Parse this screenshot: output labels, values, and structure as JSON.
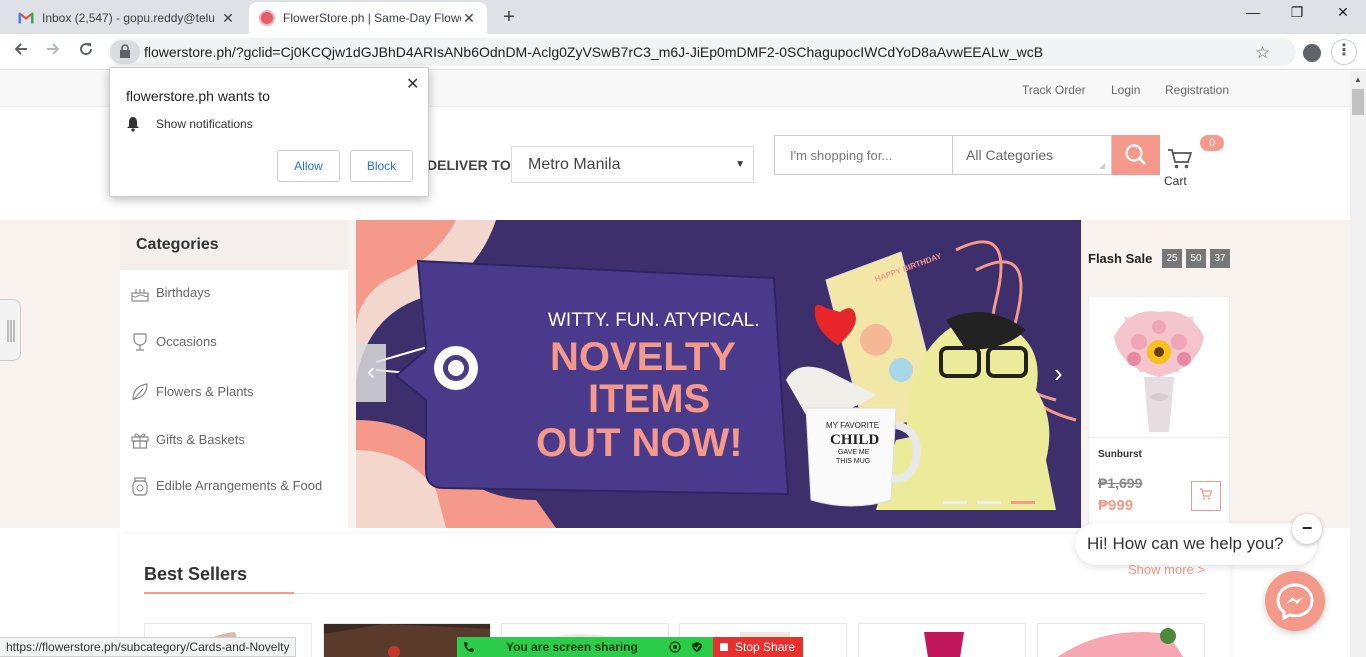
{
  "browser": {
    "tabs": [
      {
        "title": "Inbox (2,547) - gopu.reddy@telu",
        "close": "✕"
      },
      {
        "title": "FlowerStore.ph | Same-Day Flowe",
        "close": "✕"
      }
    ],
    "new_tab": "+",
    "url": "flowerstore.ph/?gclid=Cj0KCQjw1dGJBhD4ARIsANb6OdnDM-Aclg0ZyVSwB7rC3_m6J-JiEp0mDMF2-0SChagupocIWCdYoD8aAvwEEALw_wcB",
    "controls": {
      "minimize": "—",
      "restore": "❐",
      "close": "✕"
    }
  },
  "notification_popup": {
    "title": "flowerstore.ph wants to",
    "item": "Show notifications",
    "allow": "Allow",
    "block": "Block",
    "close": "✕"
  },
  "topbar": {
    "track_order": "Track Order",
    "login": "Login",
    "registration": "Registration"
  },
  "header": {
    "deliver_to": "DELIVER TO",
    "location": "Metro Manila",
    "search_placeholder": "I'm shopping for...",
    "category_select": "All Categories",
    "cart_count": "0",
    "cart_label": "Cart"
  },
  "categories": {
    "title": "Categories",
    "items": [
      {
        "label": "Birthdays",
        "icon": "cake-icon"
      },
      {
        "label": "Occasions",
        "icon": "wine-glass-icon"
      },
      {
        "label": "Flowers & Plants",
        "icon": "leaf-icon"
      },
      {
        "label": "Gifts & Baskets",
        "icon": "gift-icon"
      },
      {
        "label": "Edible Arrangements & Food",
        "icon": "jar-icon"
      }
    ]
  },
  "banner": {
    "tagline": "WITTY. FUN. ATYPICAL.",
    "headline_1": "NOVELTY",
    "headline_2": "ITEMS",
    "headline_3": "OUT NOW!",
    "mug_1": "MY FAVORITE",
    "mug_2": "CHILD",
    "mug_3": "GAVE ME",
    "mug_4": "THIS MUG",
    "card_text": "HAPPY BIRTHDAY"
  },
  "flash_sale": {
    "title": "Flash Sale",
    "timer": [
      "25",
      "50",
      "37"
    ],
    "product": {
      "name": "Sunburst",
      "old_price": "₱1,699",
      "new_price": "₱999"
    }
  },
  "best_sellers": {
    "title": "Best Sellers",
    "show_more": "Show more >"
  },
  "chat": {
    "greeting": "Hi! How can we help you?",
    "minimize": "−"
  },
  "status_url": "https://flowerstore.ph/subcategory/Cards-and-Novelty",
  "screen_share": {
    "text": "You are screen sharing",
    "stop": "Stop Share"
  },
  "colors": {
    "accent": "#f5998a",
    "banner_bg": "#3d2f6b",
    "share_green": "#2bcc4a",
    "stop_red": "#e8312f"
  }
}
